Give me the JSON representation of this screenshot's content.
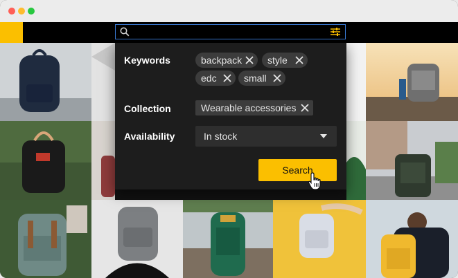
{
  "window": {
    "controls": [
      "close",
      "minimize",
      "zoom"
    ]
  },
  "search": {
    "value": "",
    "placeholder": ""
  },
  "filter_panel": {
    "keywords_label": "Keywords",
    "keywords": [
      "backpack",
      "style",
      "edc",
      "small"
    ],
    "collection_label": "Collection",
    "collection": "Wearable accessories",
    "availability_label": "Availability",
    "availability_value": "In stock",
    "search_button": "Search"
  },
  "colors": {
    "accent": "#fbbf00",
    "panel": "#1d1d1d",
    "chip": "#3c3c3c",
    "focus": "#3a7bd5"
  },
  "icons": [
    "search-icon",
    "filter-sliders-icon",
    "remove-icon",
    "dropdown-caret-icon",
    "hand-pointer-icon"
  ],
  "grid": {
    "images": 15
  }
}
